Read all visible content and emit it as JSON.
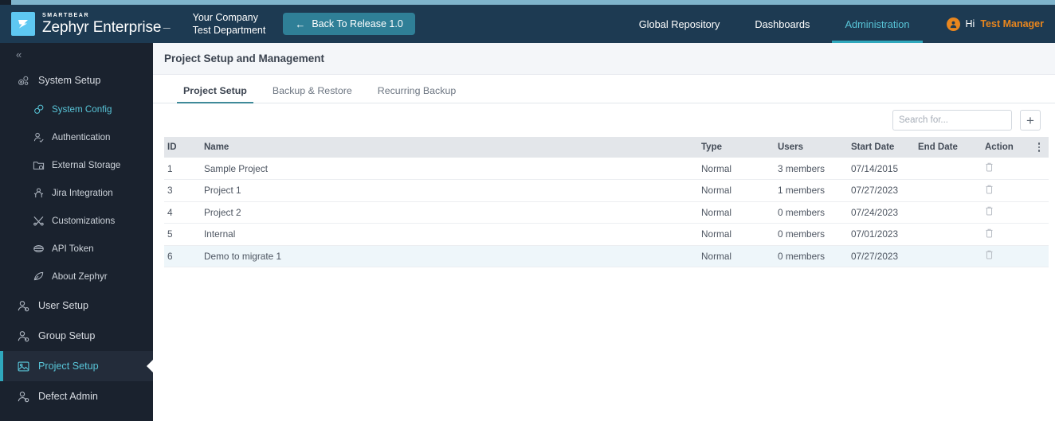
{
  "brand": {
    "smartbear": "SMARTBEAR",
    "product": "Zephyr Enterprise",
    "tm": "™",
    "logo_icon": "zephyr-wing-logo"
  },
  "header": {
    "company_line1": "Your Company",
    "company_line2": "Test Department",
    "back_button": "Back To Release 1.0",
    "back_arrow_icon": "arrow-left-icon",
    "nav": [
      {
        "label": "Global Repository",
        "active": false
      },
      {
        "label": "Dashboards",
        "active": false
      },
      {
        "label": "Administration",
        "active": true
      }
    ],
    "user": {
      "greeting": "Hi",
      "name": "Test Manager",
      "avatar_icon": "user-avatar-icon"
    },
    "colors": {
      "background": "#1d3a52",
      "top_strip": "#7fb4cc",
      "accent_teal": "#2fa8bd",
      "active_nav_text": "#58c5d8",
      "user_name": "#e8861e",
      "back_button": "#2f7f97",
      "logo_square": "#5ec8f2"
    }
  },
  "sidebar": {
    "collapse_icon": "double-chevron-left-icon",
    "items": [
      {
        "label": "System Setup",
        "icon": "system-setup-gear-icon",
        "level": 0,
        "active": false,
        "teal": false
      },
      {
        "label": "System Config",
        "icon": "system-config-icon",
        "level": 1,
        "active": false,
        "teal": true
      },
      {
        "label": "Authentication",
        "icon": "authentication-user-icon",
        "level": 1,
        "active": false,
        "teal": false
      },
      {
        "label": "External Storage",
        "icon": "external-storage-folder-icon",
        "level": 1,
        "active": false,
        "teal": false
      },
      {
        "label": "Jira Integration",
        "icon": "jira-integration-icon",
        "level": 1,
        "active": false,
        "teal": false
      },
      {
        "label": "Customizations",
        "icon": "customizations-tools-icon",
        "level": 1,
        "active": false,
        "teal": false
      },
      {
        "label": "API Token",
        "icon": "api-token-icon",
        "level": 1,
        "active": false,
        "teal": false
      },
      {
        "label": "About Zephyr",
        "icon": "about-zephyr-feather-icon",
        "level": 1,
        "active": false,
        "teal": false
      },
      {
        "label": "User Setup",
        "icon": "user-setup-icon",
        "level": 0,
        "active": false,
        "teal": false
      },
      {
        "label": "Group Setup",
        "icon": "group-setup-icon",
        "level": 0,
        "active": false,
        "teal": false
      },
      {
        "label": "Project Setup",
        "icon": "project-setup-image-icon",
        "level": 0,
        "active": true,
        "teal": true
      },
      {
        "label": "Defect Admin",
        "icon": "defect-admin-user-icon",
        "level": 0,
        "active": false,
        "teal": false
      }
    ],
    "colors": {
      "background": "#1a222e",
      "active_bar": "#2fa8bd",
      "active_text": "#58c5d8"
    }
  },
  "main": {
    "page_title": "Project Setup and Management",
    "tabs": [
      {
        "label": "Project Setup",
        "active": true
      },
      {
        "label": "Backup & Restore",
        "active": false
      },
      {
        "label": "Recurring Backup",
        "active": false
      }
    ],
    "toolbar": {
      "search_value": "",
      "search_placeholder": "Search for...",
      "search_icon": "search-icon",
      "add_label": "+",
      "add_icon": "plus-icon"
    },
    "table": {
      "columns": [
        "ID",
        "Name",
        "Type",
        "Users",
        "Start Date",
        "End Date",
        "Action"
      ],
      "menu_icon": "kebab-menu-icon",
      "row_action_icon": "trash-delete-icon",
      "rows": [
        {
          "id": "1",
          "name": "Sample Project",
          "type": "Normal",
          "users": "3 members",
          "start": "07/14/2015",
          "end": "",
          "highlight": false
        },
        {
          "id": "3",
          "name": "Project 1",
          "type": "Normal",
          "users": "1 members",
          "start": "07/27/2023",
          "end": "",
          "highlight": false
        },
        {
          "id": "4",
          "name": "Project 2",
          "type": "Normal",
          "users": "0 members",
          "start": "07/24/2023",
          "end": "",
          "highlight": false
        },
        {
          "id": "5",
          "name": "Internal",
          "type": "Normal",
          "users": "0 members",
          "start": "07/01/2023",
          "end": "",
          "highlight": false
        },
        {
          "id": "6",
          "name": "Demo to migrate 1",
          "type": "Normal",
          "users": "0 members",
          "start": "07/27/2023",
          "end": "",
          "highlight": true
        }
      ]
    }
  }
}
